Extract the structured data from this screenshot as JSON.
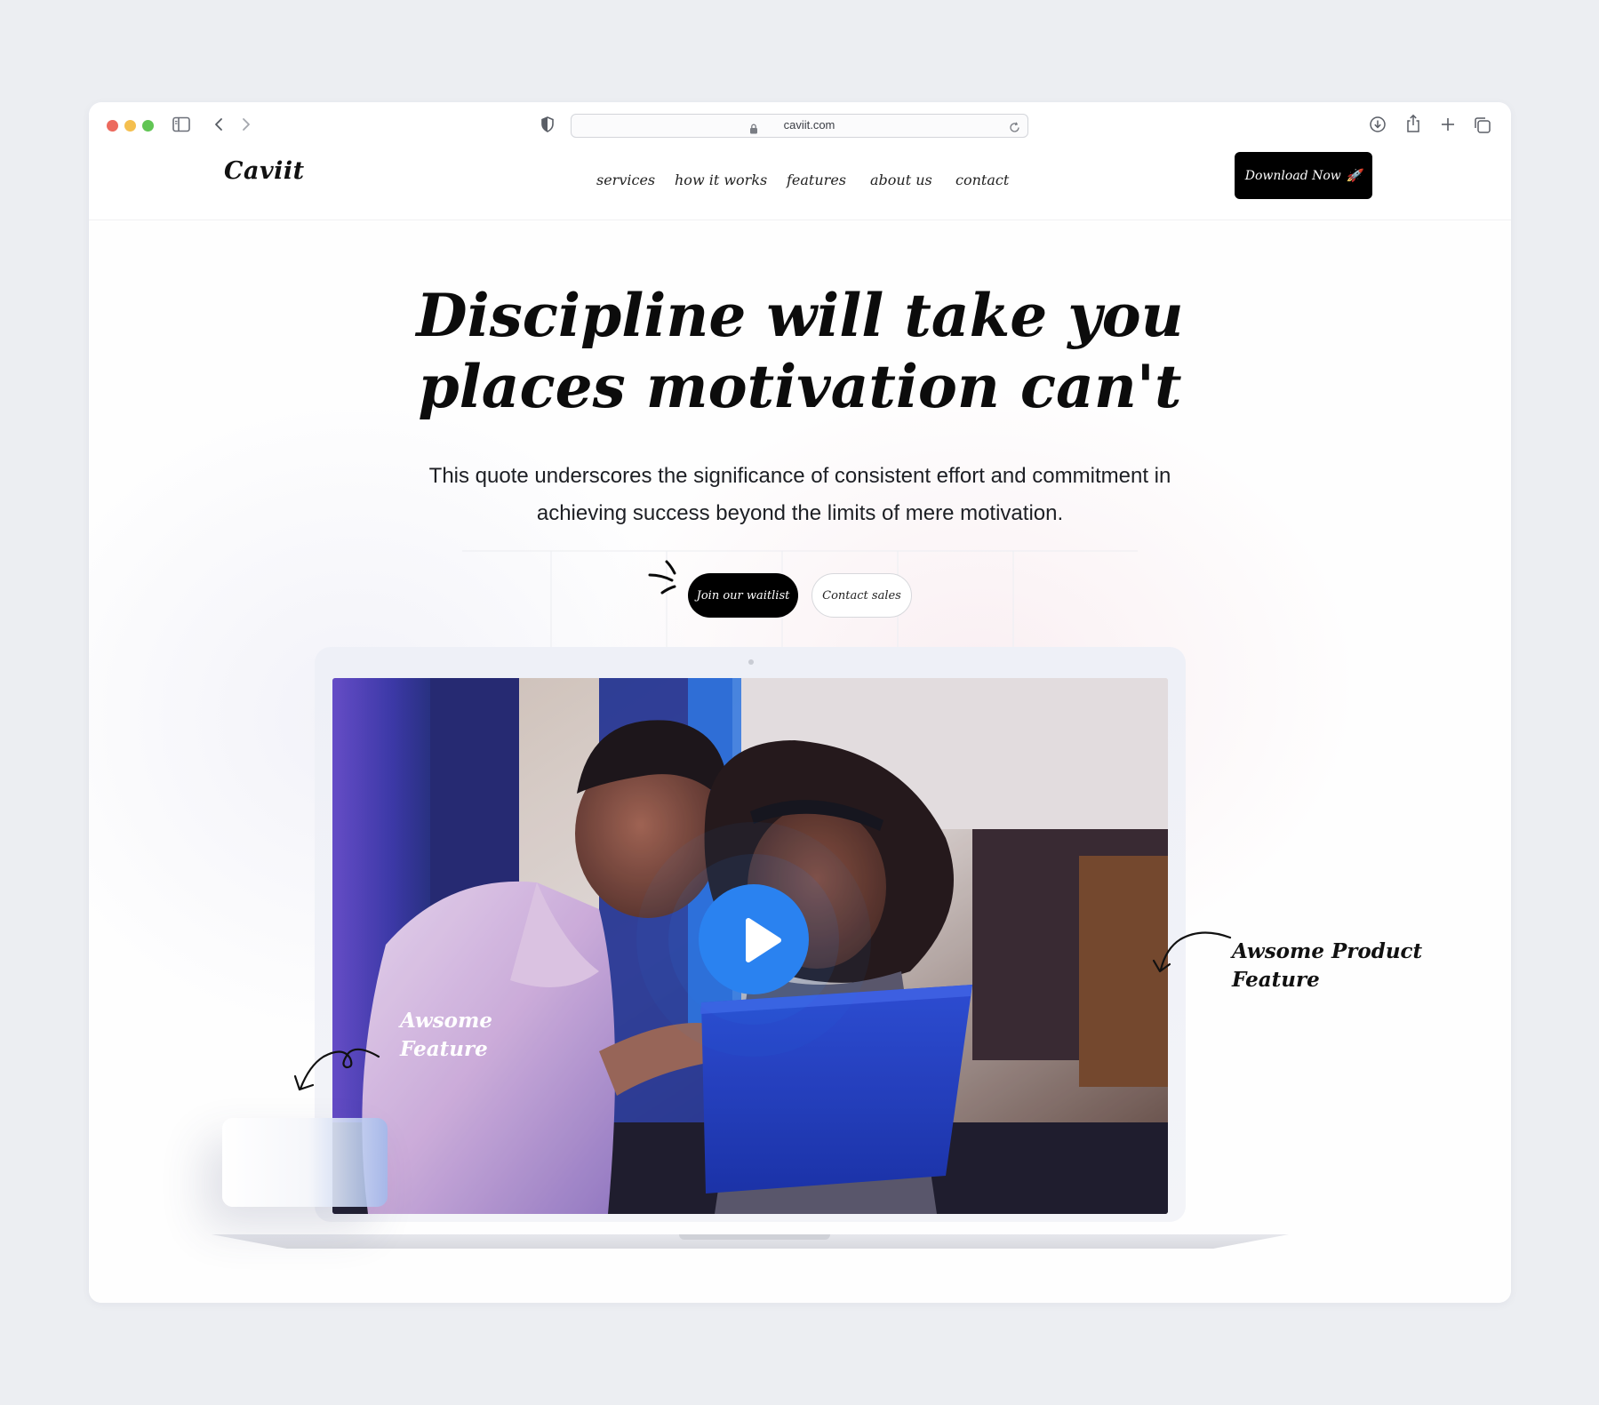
{
  "browser": {
    "url": "caviit.com"
  },
  "site": {
    "logo": "Caviit",
    "nav": [
      "services",
      "how it works",
      "features",
      "about us",
      "contact"
    ],
    "download_label": "Download Now",
    "download_emoji": "🚀"
  },
  "hero": {
    "title_line1": "Discipline will take you",
    "title_line2": "places motivation can't",
    "subtitle_line1": "This quote underscores the significance of consistent effort and commitment in",
    "subtitle_line2": "achieving success beyond the limits of mere motivation.",
    "cta_primary": "Join our waitlist",
    "cta_secondary": "Contact sales"
  },
  "annotations": {
    "left_line1": "Awsome",
    "left_line2": "Feature",
    "right_line1": "Awsome Product",
    "right_line2": "Feature"
  },
  "colors": {
    "accent": "#2a82f0",
    "primary_button": "#000000",
    "page_background": "#eceef2"
  },
  "icons": [
    "sidebar-icon",
    "back-chevron-icon",
    "forward-chevron-icon",
    "shield-icon",
    "lock-icon",
    "reload-icon",
    "download-icon",
    "share-icon",
    "plus-icon",
    "tabs-icon",
    "rocket-icon",
    "sparkle-icon",
    "play-icon"
  ]
}
